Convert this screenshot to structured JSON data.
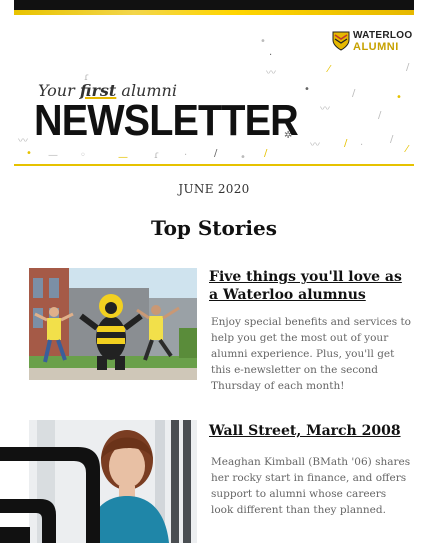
{
  "brand": {
    "logo_line1": "WATERLOO",
    "logo_line2": "ALUMNI",
    "accent_color": "#e6c200",
    "logo_icon": "shield-icon"
  },
  "masthead": {
    "kicker_pre": "Your ",
    "kicker_first": "first",
    "kicker_post": " alumni",
    "title": "NEWSLETTER"
  },
  "issue": {
    "date": "JUNE 2020"
  },
  "section": {
    "title": "Top Stories"
  },
  "stories": [
    {
      "title": "Five things you'll love as a Waterloo alumnus",
      "body": "Enjoy special benefits and services to help you get the most out of your alumni experience. Plus, you'll get this e-newsletter on the second Thursday of each month!"
    },
    {
      "title": "Wall Street, March 2008",
      "body": "Meaghan Kimball (BMath '06) shares her rocky start in finance, and offers support to alumni whose careers look different than they planned."
    }
  ]
}
